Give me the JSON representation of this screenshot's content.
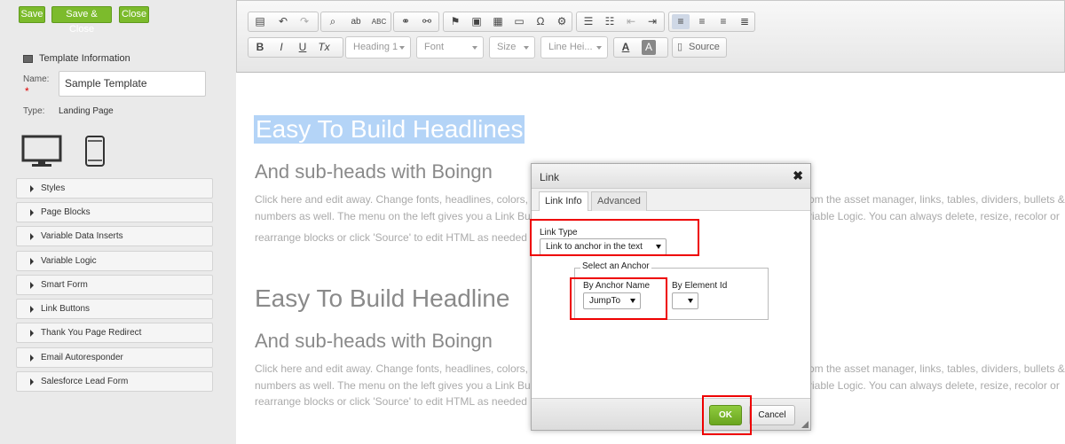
{
  "left_panel": {
    "buttons": {
      "save": "Save",
      "save_close": "Save & Close",
      "close": "Close"
    },
    "section_title": "Template Information",
    "name_label": "Name:",
    "required_mark": "*",
    "name_value": "Sample Template",
    "type_label": "Type:",
    "type_value": "Landing Page",
    "accordion": [
      "Styles",
      "Page Blocks",
      "Variable Data Inserts",
      "Variable Logic",
      "Smart Form",
      "Link Buttons",
      "Thank You Page Redirect",
      "Email Autoresponder",
      "Salesforce Lead Form"
    ]
  },
  "toolbar": {
    "heading": "Heading 1",
    "font": "Font",
    "size": "Size",
    "line_height": "Line Hei...",
    "source": "Source",
    "bold": "B",
    "italic": "I",
    "underline": "U",
    "clear_format": "Tx",
    "text_color": "A",
    "bg_color": "A"
  },
  "content": {
    "headline": "Easy To Build Headlines",
    "headline2": "Easy To Build Headline",
    "subhead": "And sub-heads with Boingn",
    "para_l1": "Click here and edit away. Change fonts, headlines, colors,",
    "para_r1": "om the asset manager, links, tables, dividers, bullets &",
    "para_l2": "numbers as well. The menu on the left gives you a Link Bu",
    "para_r2": "riable Logic. You can always delete, resize, recolor or",
    "para_l3a": "rearrange blocks or click 'Source' to edit HTML as needed",
    "para_l3b": "rearrange blocks or click 'Source' to edit HTML as needed",
    "para_r2b": "riable Logic. You can always delete, resize, recolor or"
  },
  "dialog": {
    "title": "Link",
    "close": "✖",
    "tabs": [
      "Link Info",
      "Advanced"
    ],
    "link_type_label": "Link Type",
    "link_type_value": "Link to anchor in the text",
    "anchor_legend": "Select an Anchor",
    "by_anchor_name": "By Anchor Name",
    "anchor_value": "JumpTo",
    "by_element_id": "By Element Id",
    "element_value": "",
    "ok": "OK",
    "cancel": "Cancel"
  },
  "colors": {
    "save_green": "#7cbb2c",
    "selection_blue": "#b4d4f7",
    "highlight_red": "#e00000"
  }
}
